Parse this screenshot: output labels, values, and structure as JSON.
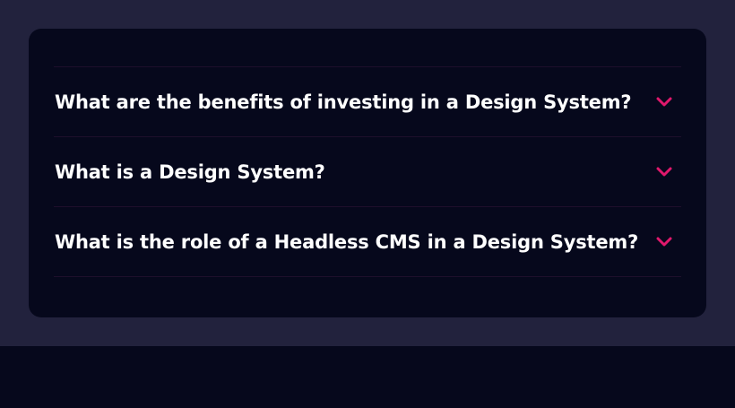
{
  "colors": {
    "page_background": "#22223d",
    "card_background": "#06081c",
    "divider": "#1e0f2c",
    "question_text": "#ffffff",
    "chevron_accent": "#e0186c"
  },
  "faq": {
    "items": [
      {
        "question": "What are the benefits of investing in a Design System?",
        "icon": "chevron-down-icon",
        "expanded": false
      },
      {
        "question": "What is a Design System?",
        "icon": "chevron-down-icon",
        "expanded": false
      },
      {
        "question": "What is the role of a Headless CMS in a Design System?",
        "icon": "chevron-down-icon",
        "expanded": false
      }
    ]
  }
}
